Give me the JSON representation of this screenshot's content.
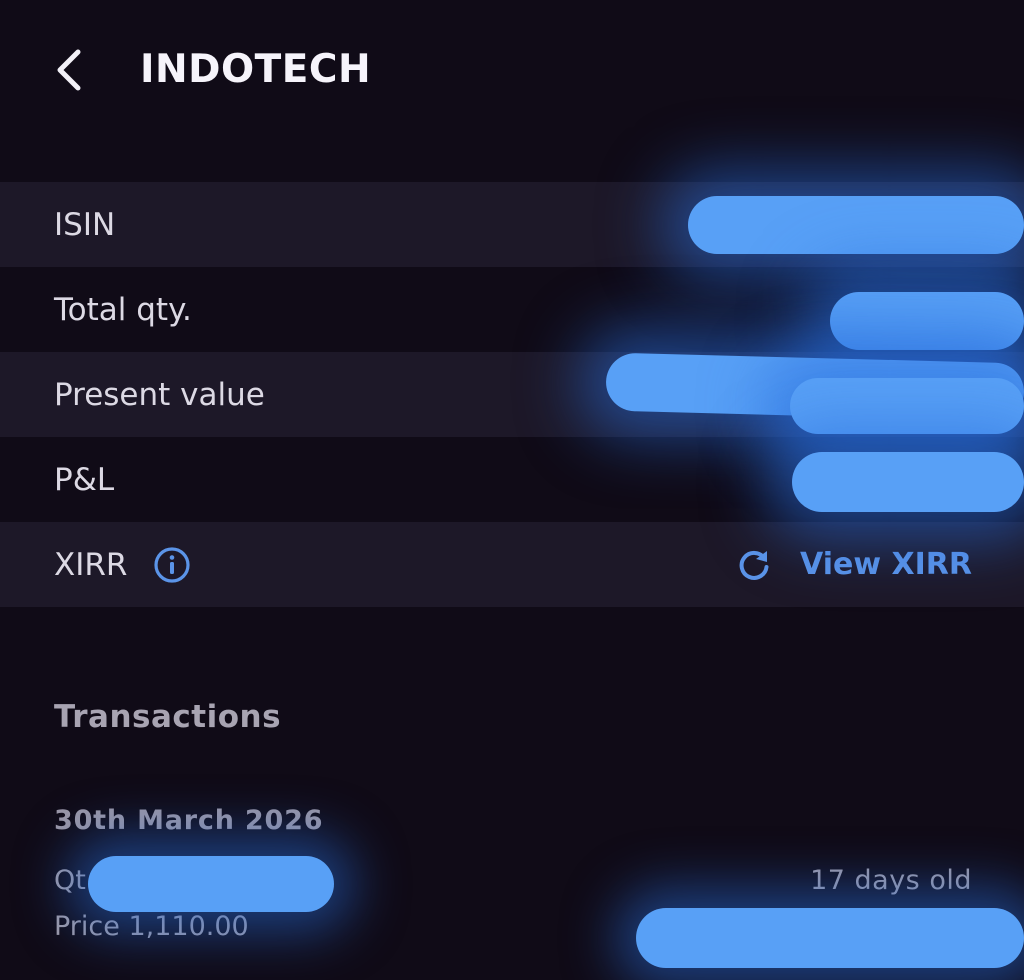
{
  "header": {
    "title": "INDOTECH",
    "back_icon": "chevron-left-icon"
  },
  "details": {
    "rows": [
      {
        "label": "ISIN",
        "value_redacted": true
      },
      {
        "label": "Total qty.",
        "value_redacted": true
      },
      {
        "label": "Present value",
        "value_redacted": true
      },
      {
        "label": "P&L",
        "value_redacted": true
      },
      {
        "label": "XIRR",
        "info_icon": "info-icon",
        "action_label": "View XIRR",
        "action_icon": "refresh-icon"
      }
    ]
  },
  "transactions": {
    "title": "Transactions",
    "items": [
      {
        "date": "30th March 2026",
        "qty_prefix": "Qt",
        "age": "17 days old",
        "price_label": "Price",
        "price": "1,110.00"
      }
    ]
  },
  "colors": {
    "background": "#100b17",
    "row_shade": "#1d1828",
    "accent": "#5b94e8",
    "redaction": "#58a0f6"
  }
}
